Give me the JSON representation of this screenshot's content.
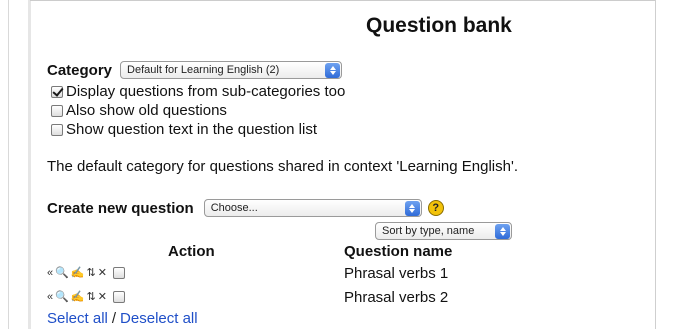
{
  "page": {
    "title": "Question bank"
  },
  "category": {
    "label": "Category",
    "selected": "Default for Learning English (2)"
  },
  "options": {
    "subcategories": {
      "label": "Display questions from sub-categories too",
      "checked": true
    },
    "old_questions": {
      "label": "Also show old questions",
      "checked": false
    },
    "question_text": {
      "label": "Show question text in the question list",
      "checked": false
    }
  },
  "info_text": "The default category for questions shared in context 'Learning English'.",
  "create": {
    "label": "Create new question",
    "selected": "Choose...",
    "help_icon_glyph": "?"
  },
  "sort": {
    "selected": "Sort by type, name"
  },
  "table": {
    "headers": {
      "action": "Action",
      "name": "Question name"
    },
    "rows": [
      {
        "name": "Phrasal verbs 1",
        "selected": false
      },
      {
        "name": "Phrasal verbs 2",
        "selected": false
      }
    ],
    "action_icons": {
      "preview": "«",
      "zoom": "🔍",
      "edit": "✍",
      "move": "⇅",
      "delete": "✕"
    }
  },
  "selection": {
    "select_all": "Select all",
    "separator": "/",
    "deselect_all": "Deselect all"
  },
  "colors": {
    "link": "#1f4fc8",
    "select_arrow": "#2f6bd8",
    "help_icon": "#f2c20a"
  }
}
